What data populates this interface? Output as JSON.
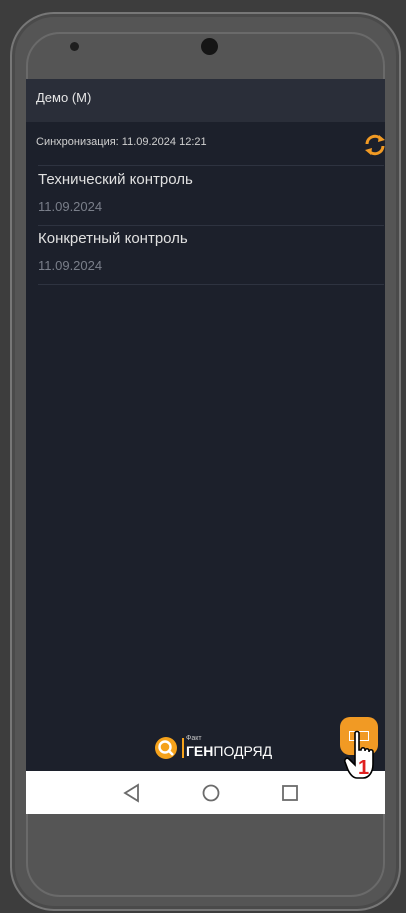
{
  "app": {
    "title": "Демо (М)",
    "sync_text": "Синхронизация: 11.09.2024 12:21"
  },
  "list": [
    {
      "title": "Технический контроль",
      "date": "11.09.2024"
    },
    {
      "title": "Конкретный контроль",
      "date": "11.09.2024"
    }
  ],
  "logo": {
    "small": "Факт",
    "big_bold": "ГЕН",
    "big_rest": "ПОДРЯД"
  },
  "annotation": {
    "step_number": "1"
  },
  "icons": {
    "sync": "sync-icon",
    "fab": "menu-icon",
    "back": "back-icon",
    "home": "home-icon",
    "recents": "recents-icon"
  },
  "colors": {
    "accent": "#f19a24",
    "screen_bg": "#1c202b",
    "header_bg": "#2a2e39"
  }
}
